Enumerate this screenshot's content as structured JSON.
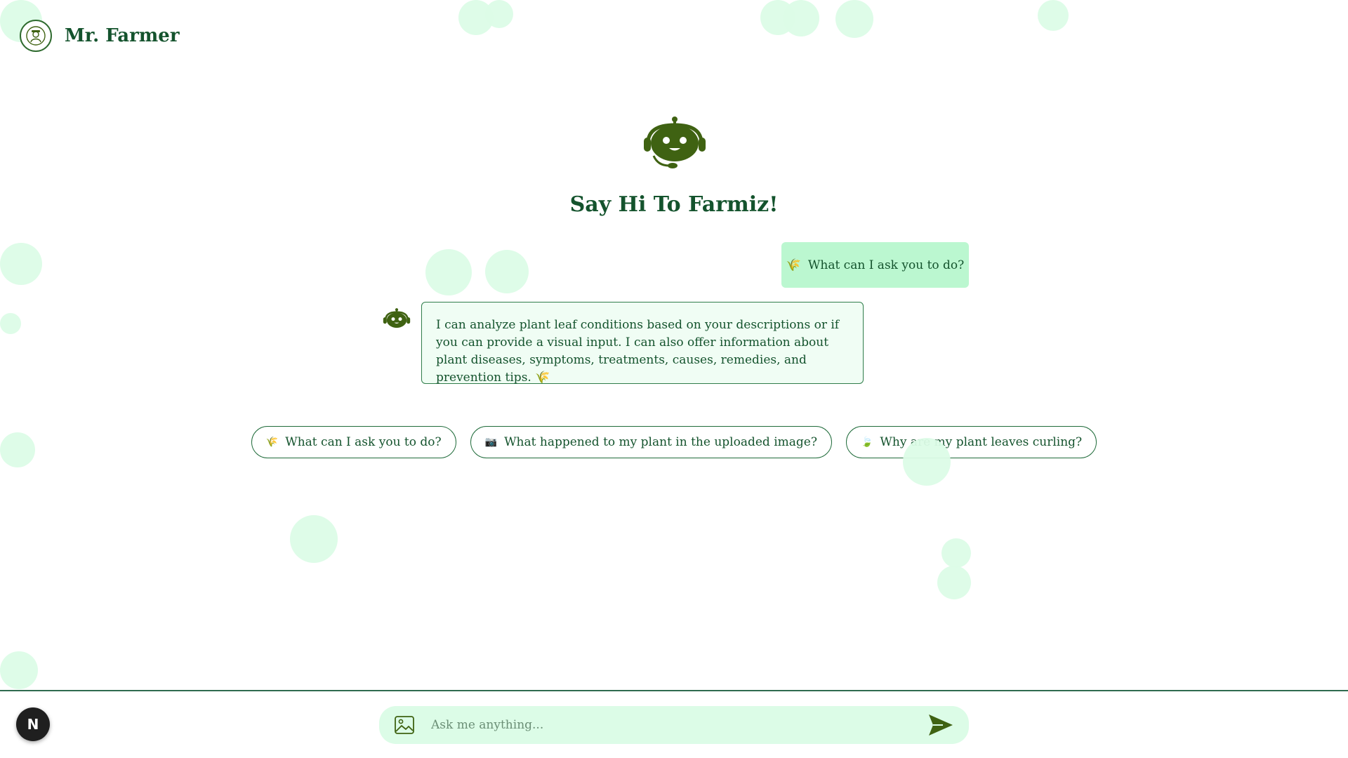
{
  "app": {
    "brand": "Mr. Farmer",
    "logo_icon": "farmer-avatar-icon"
  },
  "hero": {
    "icon": "robot-headset-icon",
    "title": "Say Hi To Farmiz!"
  },
  "chat": {
    "messages": [
      {
        "role": "user",
        "icon": "🌾",
        "text": "What can I ask you to do?"
      },
      {
        "role": "bot",
        "avatar": "robot-headset-icon",
        "text": "I can analyze plant leaf conditions based on your descriptions or if you can provide a visual input. I can also offer information about plant diseases, symptoms, treatments, causes, remedies, and prevention tips. 🌾"
      }
    ]
  },
  "suggestions": [
    {
      "icon": "🌾",
      "text": "What can I ask you to do?"
    },
    {
      "icon": "📷",
      "text": "What happened to my plant in the uploaded image?"
    },
    {
      "icon": "🍃",
      "text": "Why are my plant leaves curling?"
    }
  ],
  "input": {
    "placeholder": "Ask me anything...",
    "upload_icon": "image-icon",
    "send_icon": "send-icon"
  },
  "badge": {
    "label": "N"
  },
  "colors": {
    "primary": "#14532d",
    "accent": "#3f6212",
    "bubble_user": "#bbf7d0",
    "bubble_bot": "#f0fdf4",
    "input_bg": "#dcfce7",
    "decor": "#dcfce7"
  }
}
